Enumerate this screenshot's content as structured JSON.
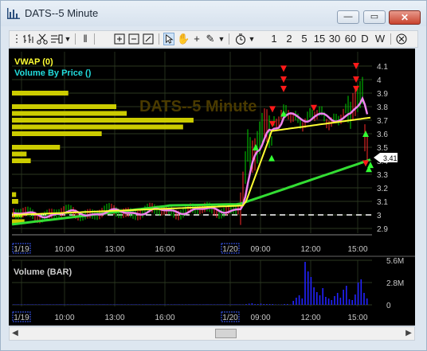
{
  "window": {
    "title": "DATS--5 Minute",
    "minimize": "—",
    "maximize": "▭",
    "close": "✕"
  },
  "toolbar": {
    "timeframes": [
      "1",
      "2",
      "5",
      "15",
      "30",
      "60",
      "D",
      "W"
    ]
  },
  "price_panel": {
    "watermark": "DATS--5 Minute",
    "indicator_vwap": "VWAP (0)",
    "indicator_vbp": "Volume By Price ()",
    "last_price": "3.41",
    "y_ticks": [
      "4.1",
      "4",
      "3.9",
      "3.8",
      "3.7",
      "3.6",
      "3.5",
      "3.4",
      "3.3",
      "3.2",
      "3.1",
      "3",
      "2.9"
    ],
    "x_ticks": [
      "1/19",
      "10:00",
      "13:00",
      "16:00",
      "1/20",
      "09:00",
      "12:00",
      "15:00"
    ]
  },
  "volume_panel": {
    "title": "Volume (BAR)",
    "y_ticks": [
      "5.6M",
      "2.8M",
      "0"
    ],
    "x_ticks": [
      "1/19",
      "10:00",
      "13:00",
      "16:00",
      "1/20",
      "09:00",
      "12:00",
      "15:00"
    ]
  },
  "colors": {
    "price_up": "#00d000",
    "vwap": "#ffff33",
    "ma": "#ee82ee",
    "trend": "#33dd33",
    "volume": "#2222ff",
    "vbp": "#cccc00",
    "marker_down": "#ff1a1a"
  },
  "chart_data": [
    {
      "type": "line",
      "title": "DATS--5 Minute",
      "ylim": [
        2.85,
        4.15
      ],
      "x": [
        "1/19",
        "10:00",
        "13:00",
        "16:00",
        "1/20",
        "09:00",
        "12:00",
        "15:00"
      ],
      "series": [
        {
          "name": "VWAP (0)",
          "values": [
            3.0,
            3.02,
            3.03,
            3.04,
            3.07,
            3.62,
            3.69,
            3.72
          ]
        }
      ],
      "volume_by_price": [
        {
          "price": 3.9,
          "rel": 0.27
        },
        {
          "price": 3.8,
          "rel": 0.5
        },
        {
          "price": 3.75,
          "rel": 0.55
        },
        {
          "price": 3.7,
          "rel": 0.87
        },
        {
          "price": 3.65,
          "rel": 0.82
        },
        {
          "price": 3.6,
          "rel": 0.43
        },
        {
          "price": 3.5,
          "rel": 0.23
        },
        {
          "price": 3.45,
          "rel": 0.07
        },
        {
          "price": 3.4,
          "rel": 0.09
        },
        {
          "price": 3.15,
          "rel": 0.02
        },
        {
          "price": 3.1,
          "rel": 0.03
        },
        {
          "price": 3.0,
          "rel": 0.05
        },
        {
          "price": 2.95,
          "rel": 0.06
        }
      ],
      "last_value": 3.41
    },
    {
      "type": "bar",
      "title": "Volume (BAR)",
      "ylim": [
        0,
        5600000
      ],
      "values_m": [
        0.1,
        0.15,
        0.2,
        0.1,
        0.1,
        0.15,
        0.1,
        0.1,
        0.1,
        0.1,
        0.05,
        0.05,
        0.05,
        0.1,
        0.1,
        0.05,
        0.5,
        0.9,
        1.2,
        0.8,
        5.4,
        4.2,
        3.5,
        2.2,
        1.6,
        1.2,
        2.1,
        1.0,
        0.8,
        0.6,
        1.1,
        1.5,
        0.9,
        1.9,
        2.4,
        0.7,
        0.6,
        1.3,
        2.8,
        3.2,
        1.5,
        0.8
      ]
    }
  ]
}
